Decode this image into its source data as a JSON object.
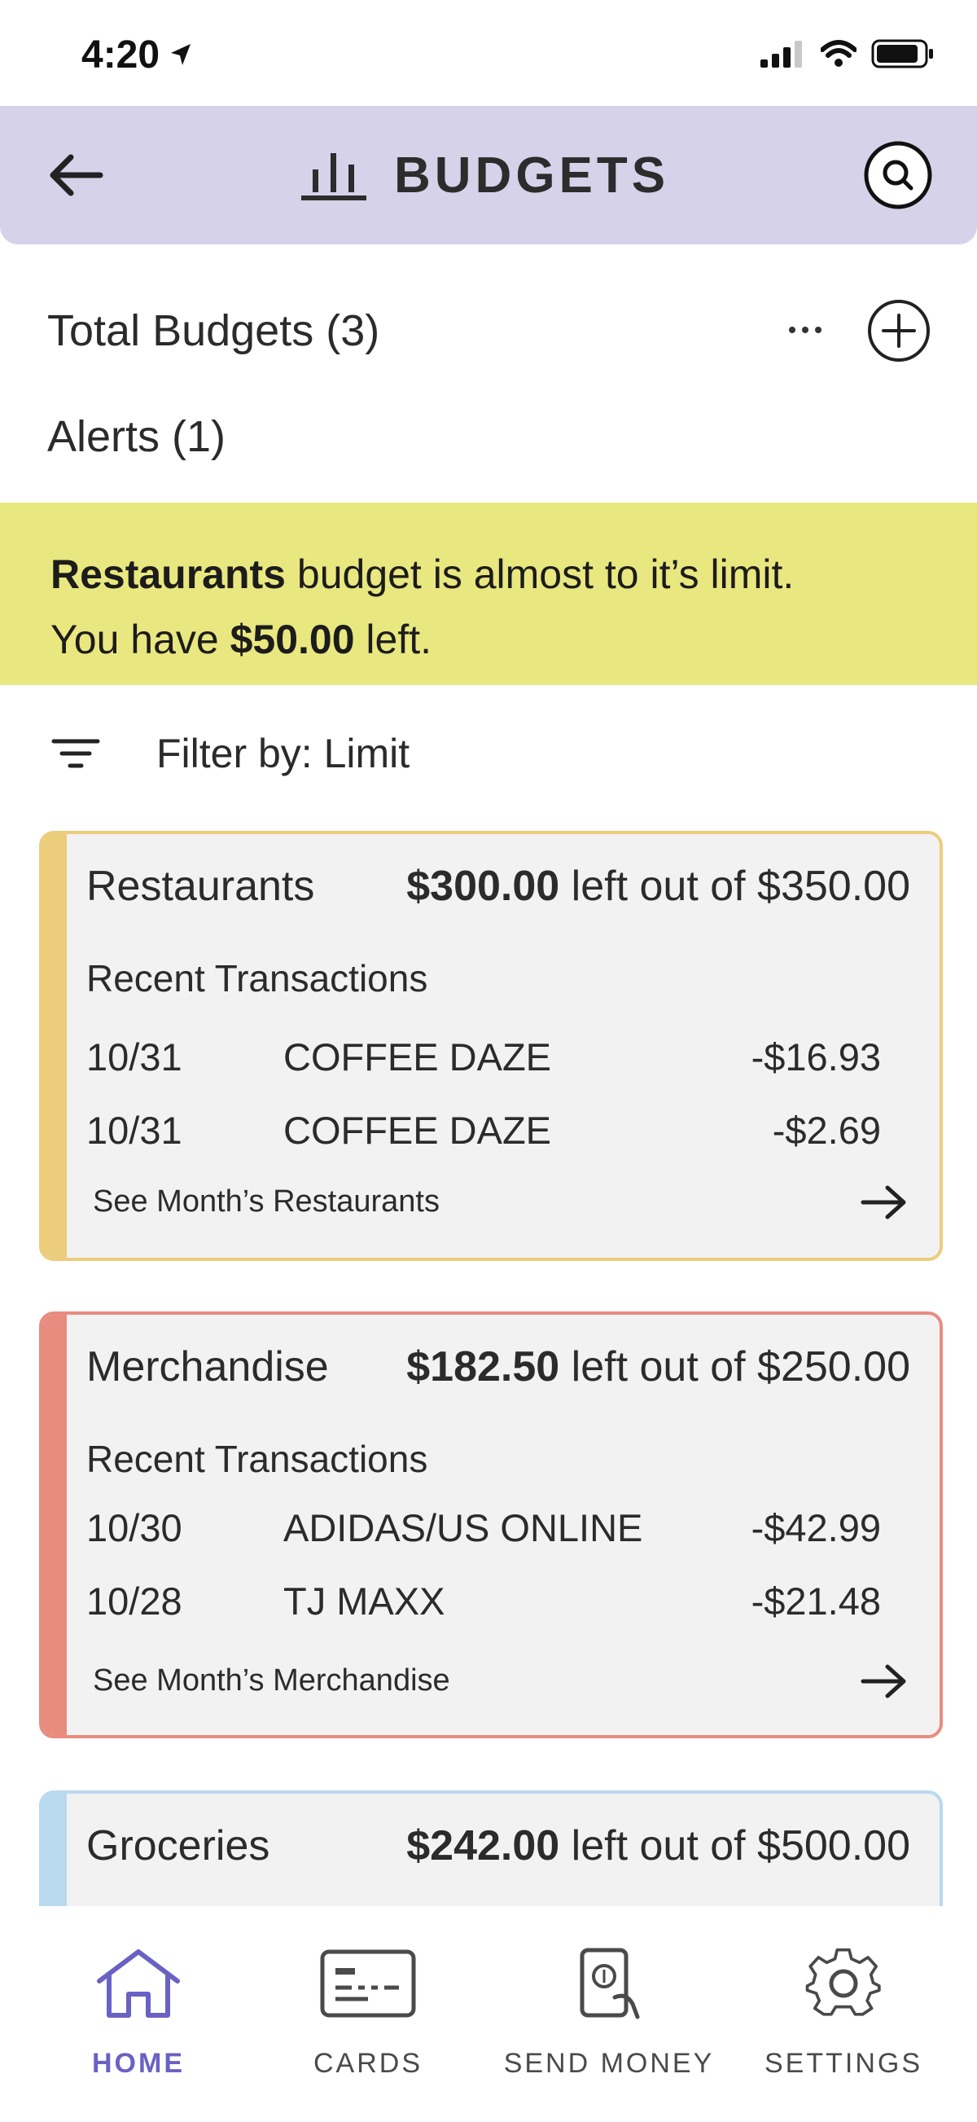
{
  "status_bar": {
    "time": "4:20"
  },
  "header": {
    "title": "BUDGETS"
  },
  "summary": {
    "total_label": "Total Budgets (3)",
    "alerts_label": "Alerts (1)"
  },
  "alert": {
    "category": "Restaurants",
    "text_1": " budget is almost to it’s limit.",
    "text_2": "You have ",
    "amount": "$50.00",
    "text_3": " left."
  },
  "filter": {
    "label": "Filter by: Limit"
  },
  "budgets": [
    {
      "name": "Restaurants",
      "left": "$300.00",
      "suffix": " left out of $350.00",
      "recent_label": "Recent Transactions",
      "transactions": [
        {
          "date": "10/31",
          "merchant": "COFFEE DAZE",
          "amount": "-$16.93"
        },
        {
          "date": "10/31",
          "merchant": "COFFEE DAZE",
          "amount": "-$2.69"
        }
      ],
      "see_link": "See Month’s Restaurants",
      "accent_color": "#ebcd7b"
    },
    {
      "name": "Merchandise",
      "left": "$182.50",
      "suffix": " left out of $250.00",
      "recent_label": "Recent Transactions",
      "transactions": [
        {
          "date": "10/30",
          "merchant": "ADIDAS/US ONLINE",
          "amount": "-$42.99"
        },
        {
          "date": "10/28",
          "merchant": "TJ MAXX",
          "amount": "-$21.48"
        }
      ],
      "see_link": "See Month’s Merchandise",
      "accent_color": "#e88c80"
    },
    {
      "name": "Groceries",
      "left": "$242.00",
      "suffix": " left out of $500.00",
      "accent_color": "#b9d9ef"
    }
  ],
  "nav": {
    "home": "HOME",
    "cards": "CARDS",
    "send_money": "SEND MONEY",
    "settings": "SETTINGS",
    "active_color": "#6a61c4"
  }
}
